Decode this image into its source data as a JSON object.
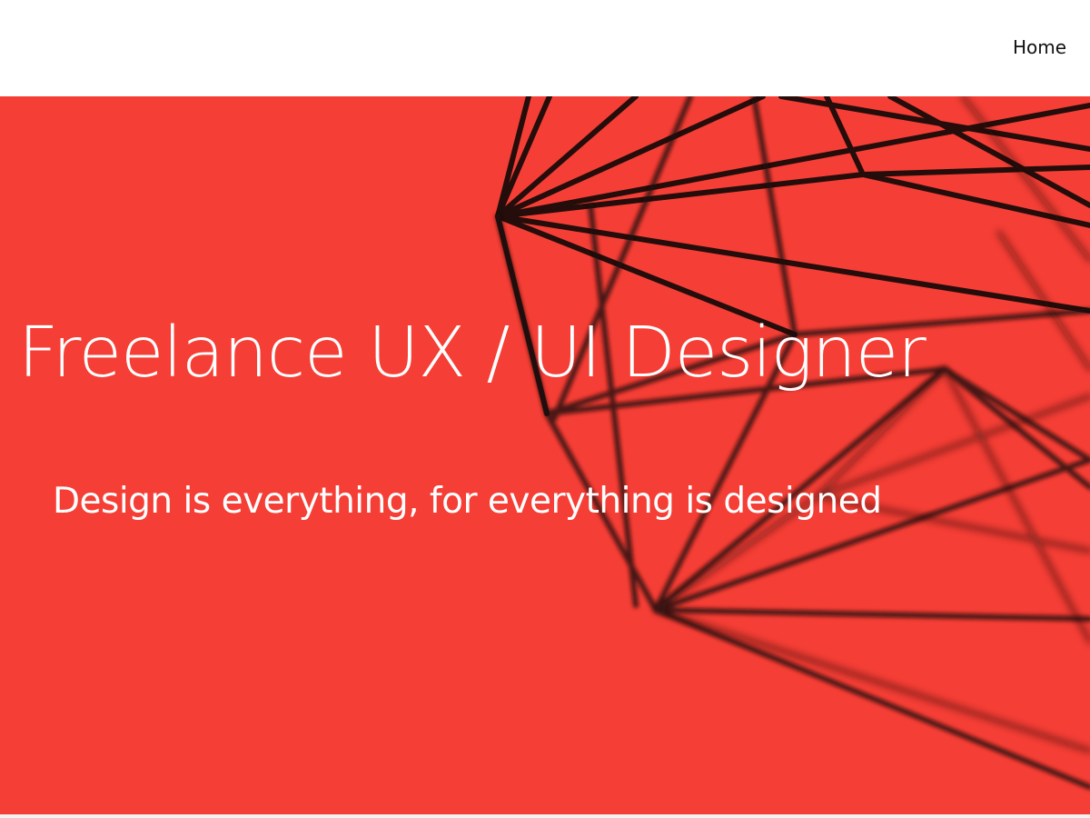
{
  "nav": {
    "home_label": "Home"
  },
  "hero": {
    "title": "Freelance UX / UI Designer",
    "tagline": "Design is everything, for everything is designed",
    "background_color": "#f53e35",
    "image_description_icon": "wireframe-polyhedron-image"
  },
  "colors": {
    "hero_background": "#f53e35",
    "wire": "#1a0b09",
    "text_on_hero": "#ffffff",
    "nav_text": "#111111"
  }
}
